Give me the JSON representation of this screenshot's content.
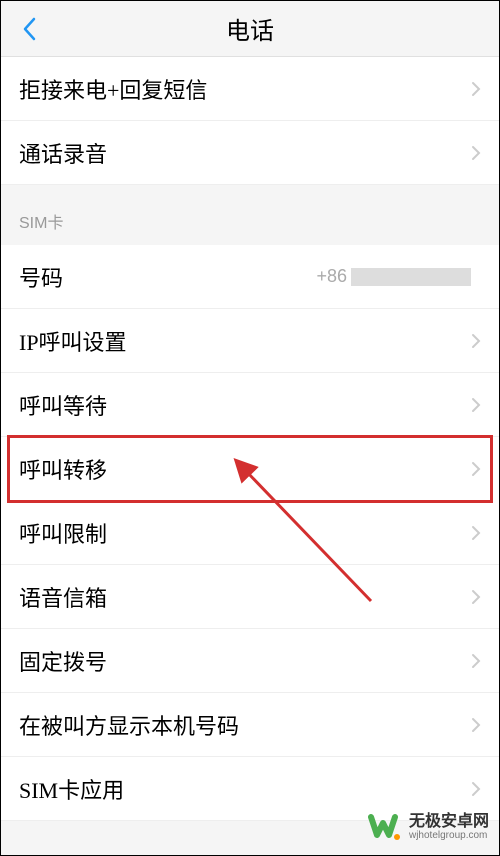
{
  "header": {
    "title": "电话"
  },
  "top_section": {
    "items": [
      {
        "label": "拒接来电+回复短信"
      },
      {
        "label": "通话录音"
      }
    ]
  },
  "sim_section": {
    "header": "SIM卡",
    "items": [
      {
        "label": "号码",
        "value_prefix": "+86",
        "value_redacted": true
      },
      {
        "label": "IP呼叫设置"
      },
      {
        "label": "呼叫等待"
      },
      {
        "label": "呼叫转移",
        "highlighted": true
      },
      {
        "label": "呼叫限制"
      },
      {
        "label": "语音信箱"
      },
      {
        "label": "固定拨号"
      },
      {
        "label": "在被叫方显示本机号码"
      },
      {
        "label": "SIM卡应用"
      }
    ]
  },
  "watermark": {
    "line1": "无极安卓网",
    "line2": "wjhotelgroup.com"
  }
}
